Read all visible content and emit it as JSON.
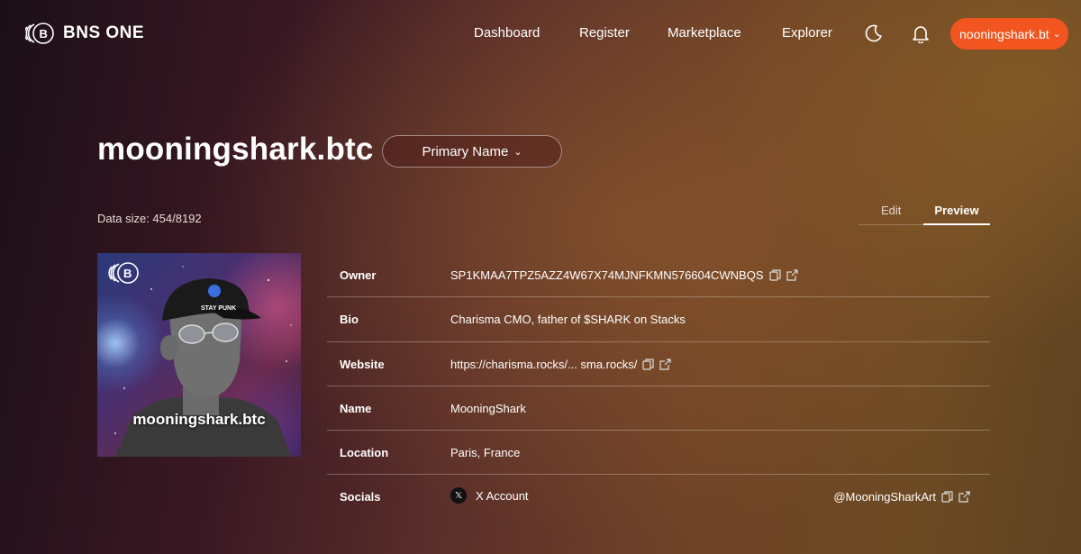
{
  "brand": {
    "name": "BNS ONE"
  },
  "nav": {
    "dashboard": "Dashboard",
    "register": "Register",
    "marketplace": "Marketplace",
    "explorer": "Explorer"
  },
  "header": {
    "user_label": "nooningshark.bt",
    "theme_icon": "moon-icon",
    "notification_icon": "bell-icon"
  },
  "profile": {
    "title": "mooningshark.btc",
    "primary_button": "Primary Name",
    "data_size": "Data size: 454/8192",
    "avatar_caption": "mooningshark.btc",
    "avatar_cap_text": "STAY PUNK"
  },
  "tabs": {
    "edit": "Edit",
    "preview": "Preview",
    "active": "Preview"
  },
  "details": {
    "owner_label": "Owner",
    "owner_value": "SP1KMAA7TPZ5AZZ4W67X74MJNFKMN576604CWNBQS",
    "bio_label": "Bio",
    "bio_value": "Charisma CMO, father of $SHARK on Stacks",
    "website_label": "Website",
    "website_value": "https://charisma.rocks/... sma.rocks/",
    "name_label": "Name",
    "name_value": "MooningShark",
    "location_label": "Location",
    "location_value": "Paris, France",
    "socials_label": "Socials",
    "social_account": "X Account",
    "social_handle": "@MooningSharkArt"
  },
  "colors": {
    "accent": "#f2551f"
  }
}
